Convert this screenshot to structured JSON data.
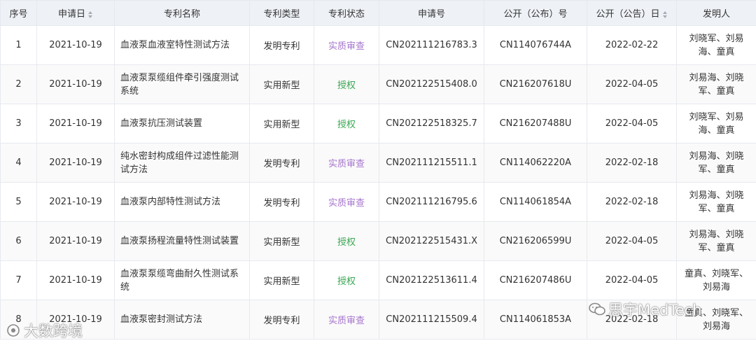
{
  "table": {
    "headers": {
      "index": "序号",
      "apply_date": "申请日",
      "name": "专利名称",
      "type": "专利类型",
      "status": "专利状态",
      "apply_no": "申请号",
      "pub_no": "公开（公布）号",
      "pub_date": "公开（公告）日",
      "inventors": "发明人"
    },
    "rows": [
      {
        "index": "1",
        "apply_date": "2021-10-19",
        "name": "血液泵血液室特性测试方法",
        "type": "发明专利",
        "status": "实质审查",
        "apply_no": "CN202111216783.3",
        "pub_no": "CN114076744A",
        "pub_date": "2022-02-22",
        "inventors": "刘晓军、刘易海、童真"
      },
      {
        "index": "2",
        "apply_date": "2021-10-19",
        "name": "血液泵泵缆组件牵引强度测试系统",
        "type": "实用新型",
        "status": "授权",
        "apply_no": "CN202122515408.0",
        "pub_no": "CN216207618U",
        "pub_date": "2022-04-05",
        "inventors": "刘易海、刘晓军、童真"
      },
      {
        "index": "3",
        "apply_date": "2021-10-19",
        "name": "血液泵抗压测试装置",
        "type": "实用新型",
        "status": "授权",
        "apply_no": "CN202122518325.7",
        "pub_no": "CN216207488U",
        "pub_date": "2022-04-05",
        "inventors": "刘晓军、刘易海、童真"
      },
      {
        "index": "4",
        "apply_date": "2021-10-19",
        "name": "纯水密封构成组件过滤性能测试方法",
        "type": "发明专利",
        "status": "实质审查",
        "apply_no": "CN202111215511.1",
        "pub_no": "CN114062220A",
        "pub_date": "2022-02-18",
        "inventors": "刘易海、刘晓军、童真"
      },
      {
        "index": "5",
        "apply_date": "2021-10-19",
        "name": "血液泵内部特性测试方法",
        "type": "发明专利",
        "status": "实质审查",
        "apply_no": "CN202111216795.6",
        "pub_no": "CN114061854A",
        "pub_date": "2022-02-18",
        "inventors": "刘易海、刘晓军、童真"
      },
      {
        "index": "6",
        "apply_date": "2021-10-19",
        "name": "血液泵扬程流量特性测试装置",
        "type": "实用新型",
        "status": "授权",
        "apply_no": "CN202122515431.X",
        "pub_no": "CN216206599U",
        "pub_date": "2022-04-05",
        "inventors": "刘易海、刘晓军、童真"
      },
      {
        "index": "7",
        "apply_date": "2021-10-19",
        "name": "血液泵泵缆弯曲耐久性测试系统",
        "type": "实用新型",
        "status": "授权",
        "apply_no": "CN202122513611.4",
        "pub_no": "CN216207486U",
        "pub_date": "2022-04-05",
        "inventors": "童真、刘晓军、刘易海"
      },
      {
        "index": "8",
        "apply_date": "2021-10-19",
        "name": "血液泵密封测试方法",
        "type": "发明专利",
        "status": "实质审查",
        "apply_no": "CN202111215509.4",
        "pub_no": "CN114061853A",
        "pub_date": "2022-02-18",
        "inventors": "童真、刘晓军、刘易海"
      }
    ]
  },
  "status_colors": {
    "实质审查": "#a675ce",
    "授权": "#3aa653"
  },
  "watermarks": {
    "right": "思宇MedTech",
    "left": "大数跨境"
  }
}
